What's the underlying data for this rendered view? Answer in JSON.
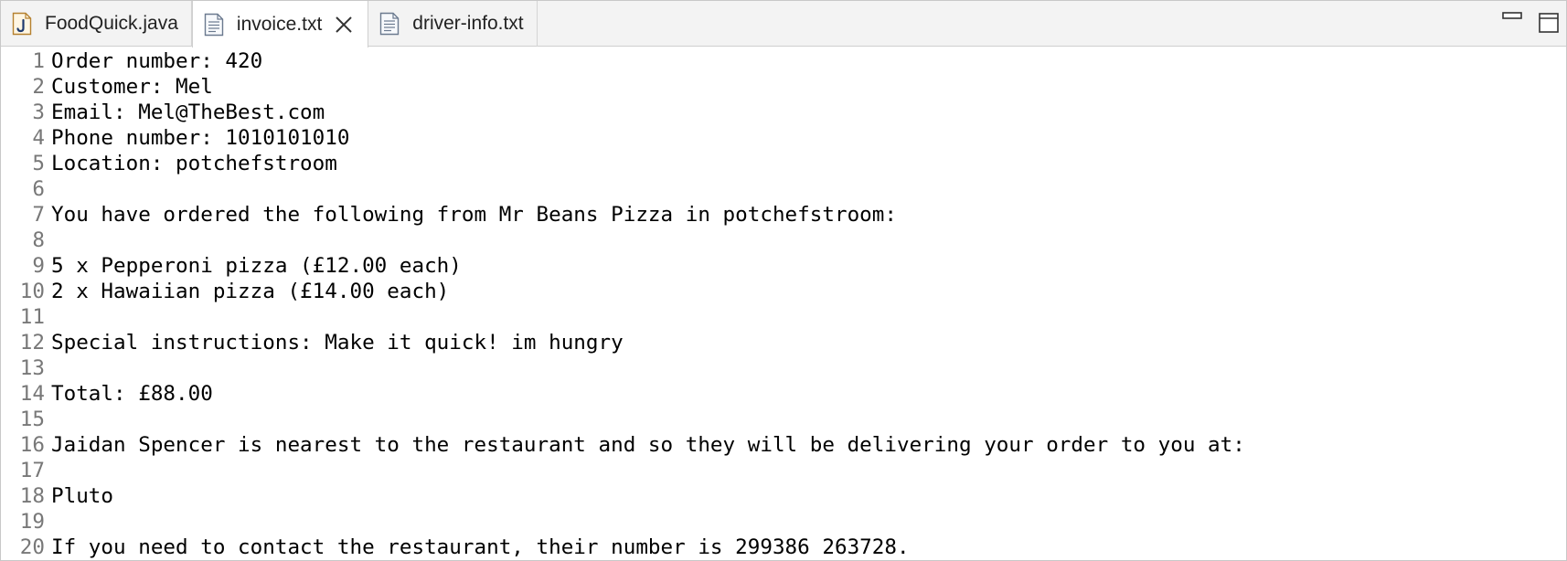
{
  "tabs": [
    {
      "label": "FoodQuick.java",
      "icon": "java-file-icon",
      "active": false
    },
    {
      "label": "invoice.txt",
      "icon": "text-file-icon",
      "active": true,
      "closable": true
    },
    {
      "label": "driver-info.txt",
      "icon": "text-file-icon",
      "active": false
    }
  ],
  "window_controls": [
    "minimize-icon",
    "maximize-icon"
  ],
  "lines": [
    {
      "num": "1",
      "text": "Order number: 420"
    },
    {
      "num": "2",
      "text": "Customer: Mel"
    },
    {
      "num": "3",
      "text": "Email: Mel@TheBest.com"
    },
    {
      "num": "4",
      "text": "Phone number: 1010101010"
    },
    {
      "num": "5",
      "text": "Location: potchefstroom"
    },
    {
      "num": "6",
      "text": ""
    },
    {
      "num": "7",
      "text": "You have ordered the following from Mr Beans Pizza in potchefstroom:"
    },
    {
      "num": "8",
      "text": ""
    },
    {
      "num": "9",
      "text": "5 x Pepperoni pizza (£12.00 each)"
    },
    {
      "num": "10",
      "text": "2 x Hawaiian pizza (£14.00 each)"
    },
    {
      "num": "11",
      "text": ""
    },
    {
      "num": "12",
      "text": "Special instructions: Make it quick! im hungry"
    },
    {
      "num": "13",
      "text": ""
    },
    {
      "num": "14",
      "text": "Total: £88.00"
    },
    {
      "num": "15",
      "text": ""
    },
    {
      "num": "16",
      "text": "Jaidan Spencer is nearest to the restaurant and so they will be delivering your order to you at:"
    },
    {
      "num": "17",
      "text": ""
    },
    {
      "num": "18",
      "text": "Pluto"
    },
    {
      "num": "19",
      "text": ""
    },
    {
      "num": "20",
      "text": "If you need to contact the restaurant, their number is 299386 263728."
    }
  ],
  "colors": {
    "tab_bar": "#f3f3f3",
    "line_number": "#787878",
    "java_icon": "#c7882a",
    "current_line": "#e8f2fe"
  }
}
